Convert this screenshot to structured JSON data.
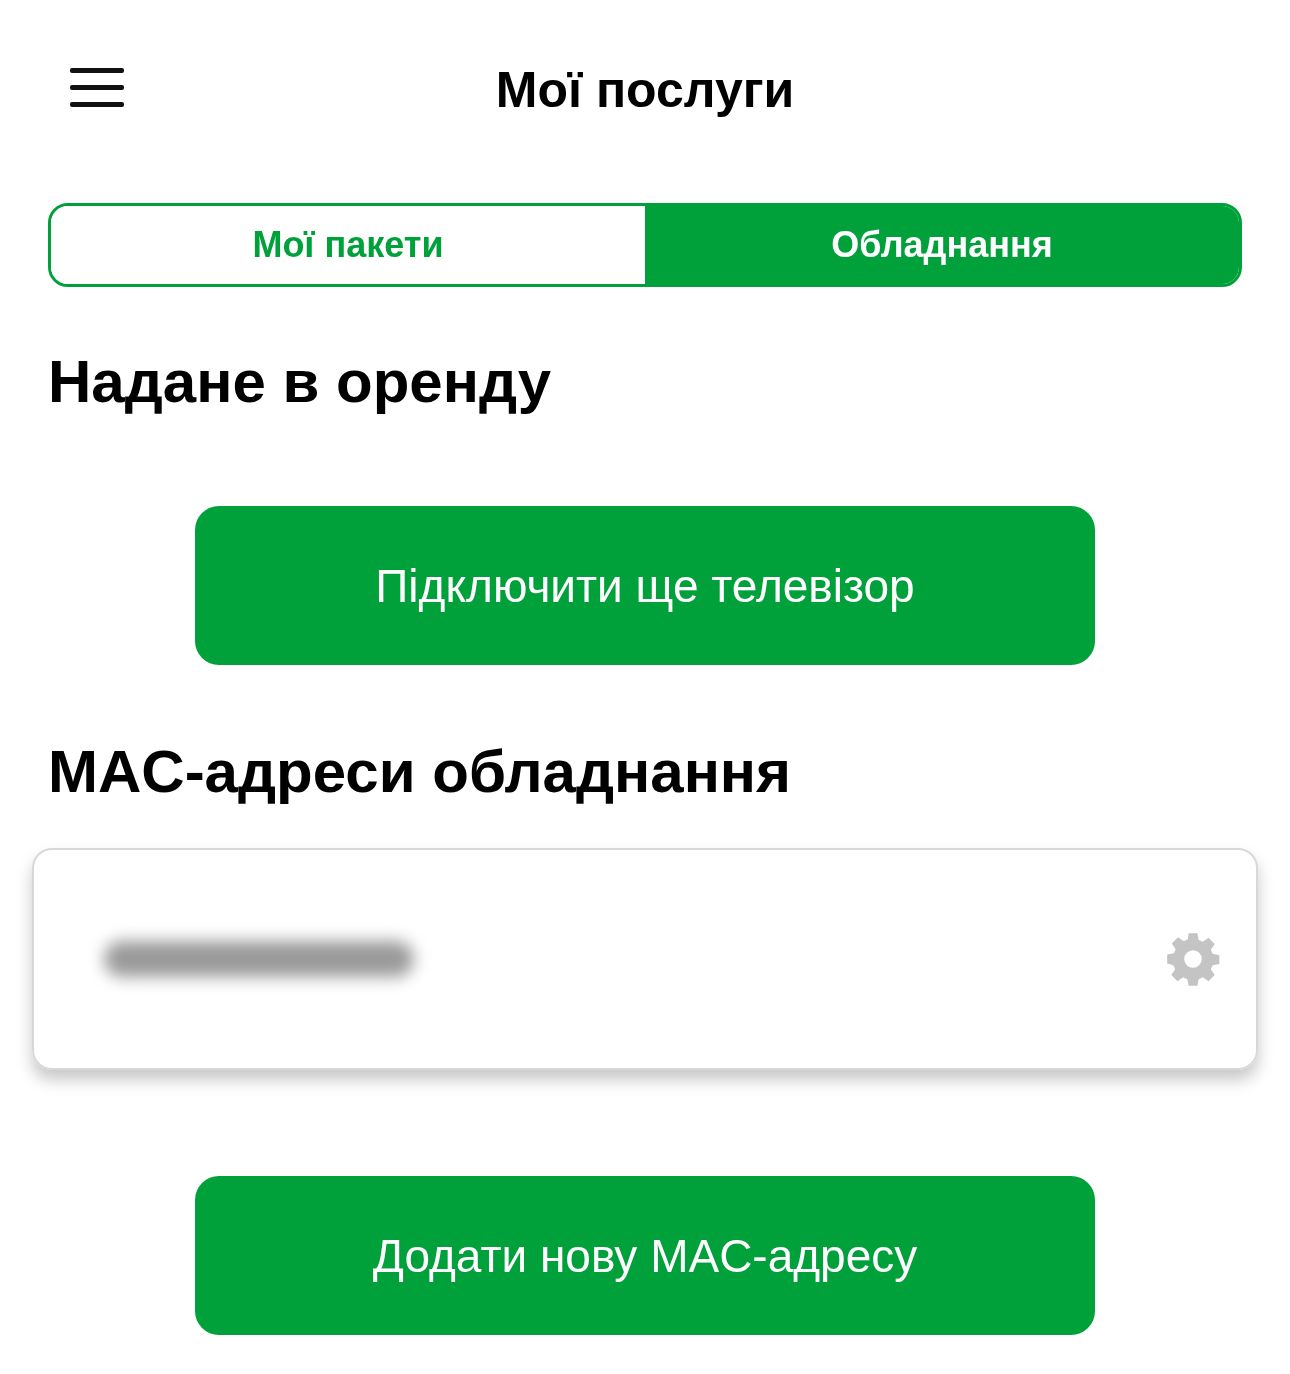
{
  "header": {
    "title": "Мої послуги"
  },
  "tabs": [
    {
      "label": "Мої пакети",
      "selected": false
    },
    {
      "label": "Обладнання",
      "selected": true
    }
  ],
  "rented_section": {
    "heading": "Надане в оренду",
    "button": "Підключити ще телевізор"
  },
  "mac_section": {
    "heading": "MAC-адреси обладнання",
    "devices": [
      {
        "kind": "redacted"
      }
    ],
    "button": "Додати нову MAC-адресу"
  }
}
